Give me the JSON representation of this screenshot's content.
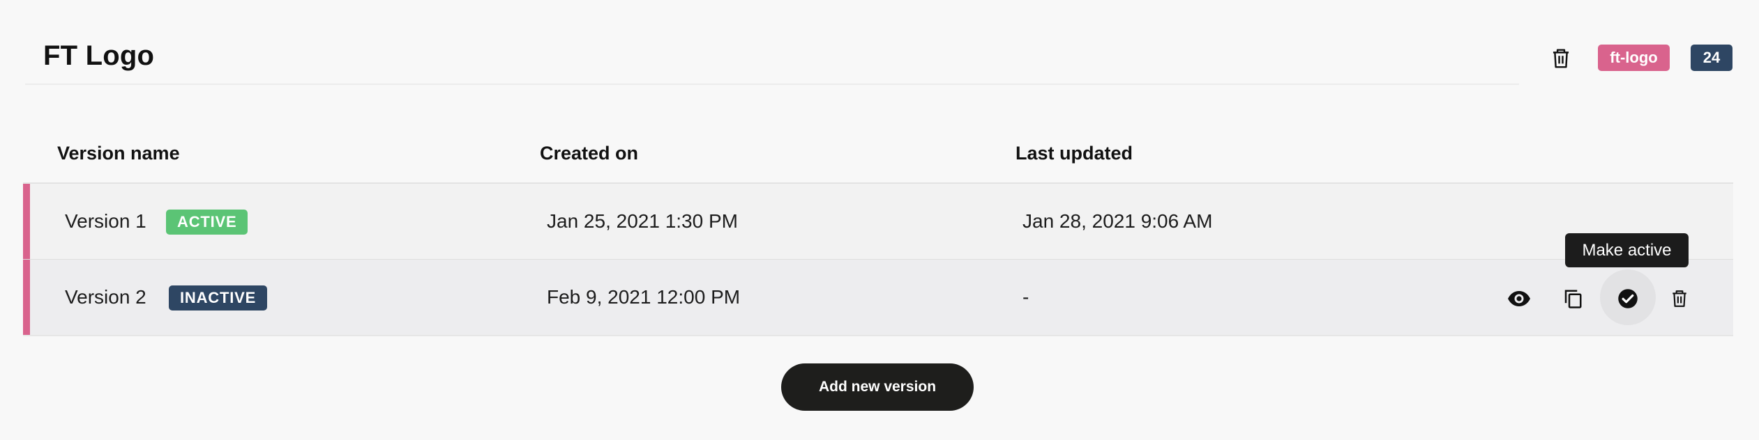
{
  "header": {
    "title": "FT Logo",
    "slug": "ft-logo",
    "id_count": "24",
    "delete_icon": "trash-icon"
  },
  "colors": {
    "background": "#f8f8f8",
    "accent_pink": "#d9638d",
    "navy": "#2e4663",
    "active_green": "#5bc475",
    "button_dark": "#1e1e1c"
  },
  "table": {
    "columns": [
      "Version name",
      "Created on",
      "Last updated"
    ],
    "rows": [
      {
        "name": "Version 1",
        "status": "ACTIVE",
        "created": "Jan 25, 2021 1:30 PM",
        "updated": "Jan 28, 2021 9:06 AM"
      },
      {
        "name": "Version 2",
        "status": "INACTIVE",
        "created": "Feb 9, 2021 12:00 PM",
        "updated": "-",
        "actions": [
          "eye-icon",
          "copy-icon",
          "check-circle-icon",
          "trash-icon"
        ]
      }
    ]
  },
  "tooltip": "Make active",
  "add_button": "Add new version"
}
